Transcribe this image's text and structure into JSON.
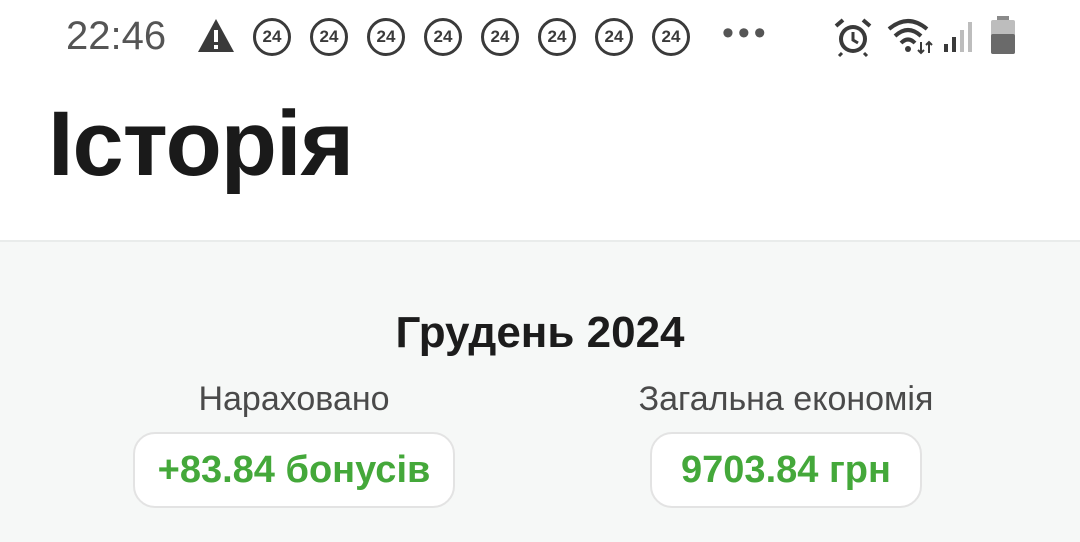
{
  "status_bar": {
    "time": "22:46",
    "notification_badges": [
      "24",
      "24",
      "24",
      "24",
      "24",
      "24",
      "24",
      "24"
    ],
    "overflow": "•••",
    "icons": [
      "warning-icon",
      "alarm-icon",
      "wifi-icon",
      "signal-icon",
      "battery-icon"
    ]
  },
  "header": {
    "title": "Історія"
  },
  "summary": {
    "month": "Грудень 2024",
    "accrued_label": "Нараховано",
    "accrued_value": "+83.84 бонусів",
    "savings_label": "Загальна економія",
    "savings_value": "9703.84 грн"
  },
  "colors": {
    "accent_green": "#44a83a",
    "panel_bg": "#f6f8f7"
  }
}
